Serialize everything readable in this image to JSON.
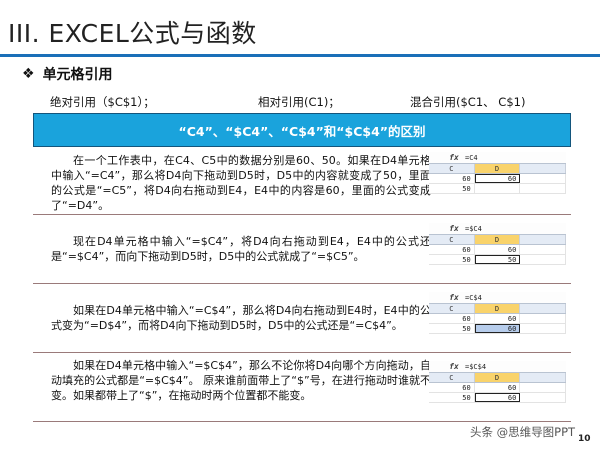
{
  "title": "III. EXCEL公式与函数",
  "section": {
    "bullet": "❖",
    "label": "单元格引用"
  },
  "refs": {
    "absolute": "绝对引用（$C$1）；",
    "relative": "相对引用(C1)；",
    "mixed": "混合引用($C1、 C$1)"
  },
  "banner": "“C4”、“$C4”、“C$4”和“$C$4”的区别",
  "panels": [
    {
      "text": "在一个工作表中，在C4、C5中的数据分别是60、50。如果在D4单元格中输入“=C4”，那么将D4向下拖动到D5时，D5中的内容就变成了50，里面的公式是“=C5”，将D4向右拖动到E4，E4中的内容是60，里面的公式变成了“=D4”。",
      "excel": {
        "formula": "=C4",
        "col_c": "C",
        "col_d": "D",
        "r1c": "60",
        "r1d": "60",
        "r2c": "50",
        "r2d": ""
      }
    },
    {
      "text": "现在D4单元格中输入“=$C4”，将D4向右拖动到E4，E4中的公式还是“=$C4”，而向下拖动到D5时，D5中的公式就成了“=$C5”。",
      "excel": {
        "formula": "=$C4",
        "col_c": "C",
        "col_d": "D",
        "r1c": "60",
        "r1d": "60",
        "r2c": "50",
        "r2d": "50"
      }
    },
    {
      "text": "如果在D4单元格中输入“=C$4”，那么将D4向右拖动到E4时，E4中的公式变为“=D$4”，而将D4向下拖动到D5时，D5中的公式还是“=C$4”。",
      "excel": {
        "formula": "=C$4",
        "col_c": "C",
        "col_d": "D",
        "r1c": "60",
        "r1d": "60",
        "r2c": "50",
        "r2d": "60"
      }
    },
    {
      "text": "如果在D4单元格中输入“=$C$4”，那么不论你将D4向哪个方向拖动，自动填充的公式都是“=$C$4”。 原来谁前面带上了“$”号，在进行拖动时谁就不变。如果都带上了“$”，在拖动时两个位置都不能变。",
      "excel": {
        "formula": "=$C$4",
        "col_c": "C",
        "col_d": "D",
        "r1c": "60",
        "r1d": "60",
        "r2c": "50",
        "r2d": "60"
      }
    }
  ],
  "watermark": "头条 @思维导图PPT",
  "page_number": "10"
}
